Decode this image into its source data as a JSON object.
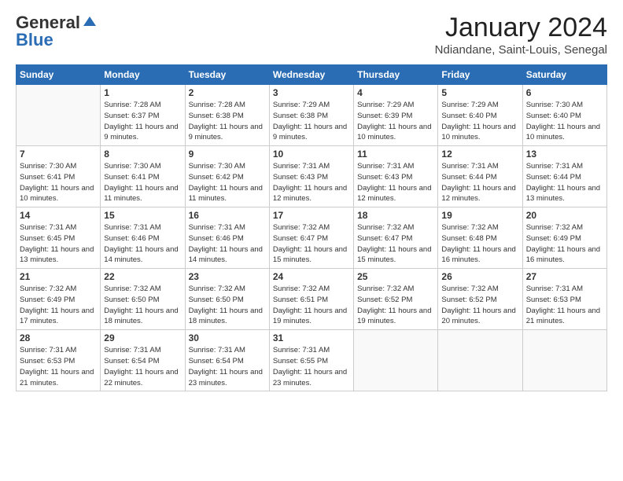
{
  "logo": {
    "general": "General",
    "blue": "Blue"
  },
  "header": {
    "month": "January 2024",
    "location": "Ndiandane, Saint-Louis, Senegal"
  },
  "weekdays": [
    "Sunday",
    "Monday",
    "Tuesday",
    "Wednesday",
    "Thursday",
    "Friday",
    "Saturday"
  ],
  "weeks": [
    [
      {
        "day": "",
        "sunrise": "",
        "sunset": "",
        "daylight": ""
      },
      {
        "day": "1",
        "sunrise": "Sunrise: 7:28 AM",
        "sunset": "Sunset: 6:37 PM",
        "daylight": "Daylight: 11 hours and 9 minutes."
      },
      {
        "day": "2",
        "sunrise": "Sunrise: 7:28 AM",
        "sunset": "Sunset: 6:38 PM",
        "daylight": "Daylight: 11 hours and 9 minutes."
      },
      {
        "day": "3",
        "sunrise": "Sunrise: 7:29 AM",
        "sunset": "Sunset: 6:38 PM",
        "daylight": "Daylight: 11 hours and 9 minutes."
      },
      {
        "day": "4",
        "sunrise": "Sunrise: 7:29 AM",
        "sunset": "Sunset: 6:39 PM",
        "daylight": "Daylight: 11 hours and 10 minutes."
      },
      {
        "day": "5",
        "sunrise": "Sunrise: 7:29 AM",
        "sunset": "Sunset: 6:40 PM",
        "daylight": "Daylight: 11 hours and 10 minutes."
      },
      {
        "day": "6",
        "sunrise": "Sunrise: 7:30 AM",
        "sunset": "Sunset: 6:40 PM",
        "daylight": "Daylight: 11 hours and 10 minutes."
      }
    ],
    [
      {
        "day": "7",
        "sunrise": "Sunrise: 7:30 AM",
        "sunset": "Sunset: 6:41 PM",
        "daylight": "Daylight: 11 hours and 10 minutes."
      },
      {
        "day": "8",
        "sunrise": "Sunrise: 7:30 AM",
        "sunset": "Sunset: 6:41 PM",
        "daylight": "Daylight: 11 hours and 11 minutes."
      },
      {
        "day": "9",
        "sunrise": "Sunrise: 7:30 AM",
        "sunset": "Sunset: 6:42 PM",
        "daylight": "Daylight: 11 hours and 11 minutes."
      },
      {
        "day": "10",
        "sunrise": "Sunrise: 7:31 AM",
        "sunset": "Sunset: 6:43 PM",
        "daylight": "Daylight: 11 hours and 12 minutes."
      },
      {
        "day": "11",
        "sunrise": "Sunrise: 7:31 AM",
        "sunset": "Sunset: 6:43 PM",
        "daylight": "Daylight: 11 hours and 12 minutes."
      },
      {
        "day": "12",
        "sunrise": "Sunrise: 7:31 AM",
        "sunset": "Sunset: 6:44 PM",
        "daylight": "Daylight: 11 hours and 12 minutes."
      },
      {
        "day": "13",
        "sunrise": "Sunrise: 7:31 AM",
        "sunset": "Sunset: 6:44 PM",
        "daylight": "Daylight: 11 hours and 13 minutes."
      }
    ],
    [
      {
        "day": "14",
        "sunrise": "Sunrise: 7:31 AM",
        "sunset": "Sunset: 6:45 PM",
        "daylight": "Daylight: 11 hours and 13 minutes."
      },
      {
        "day": "15",
        "sunrise": "Sunrise: 7:31 AM",
        "sunset": "Sunset: 6:46 PM",
        "daylight": "Daylight: 11 hours and 14 minutes."
      },
      {
        "day": "16",
        "sunrise": "Sunrise: 7:31 AM",
        "sunset": "Sunset: 6:46 PM",
        "daylight": "Daylight: 11 hours and 14 minutes."
      },
      {
        "day": "17",
        "sunrise": "Sunrise: 7:32 AM",
        "sunset": "Sunset: 6:47 PM",
        "daylight": "Daylight: 11 hours and 15 minutes."
      },
      {
        "day": "18",
        "sunrise": "Sunrise: 7:32 AM",
        "sunset": "Sunset: 6:47 PM",
        "daylight": "Daylight: 11 hours and 15 minutes."
      },
      {
        "day": "19",
        "sunrise": "Sunrise: 7:32 AM",
        "sunset": "Sunset: 6:48 PM",
        "daylight": "Daylight: 11 hours and 16 minutes."
      },
      {
        "day": "20",
        "sunrise": "Sunrise: 7:32 AM",
        "sunset": "Sunset: 6:49 PM",
        "daylight": "Daylight: 11 hours and 16 minutes."
      }
    ],
    [
      {
        "day": "21",
        "sunrise": "Sunrise: 7:32 AM",
        "sunset": "Sunset: 6:49 PM",
        "daylight": "Daylight: 11 hours and 17 minutes."
      },
      {
        "day": "22",
        "sunrise": "Sunrise: 7:32 AM",
        "sunset": "Sunset: 6:50 PM",
        "daylight": "Daylight: 11 hours and 18 minutes."
      },
      {
        "day": "23",
        "sunrise": "Sunrise: 7:32 AM",
        "sunset": "Sunset: 6:50 PM",
        "daylight": "Daylight: 11 hours and 18 minutes."
      },
      {
        "day": "24",
        "sunrise": "Sunrise: 7:32 AM",
        "sunset": "Sunset: 6:51 PM",
        "daylight": "Daylight: 11 hours and 19 minutes."
      },
      {
        "day": "25",
        "sunrise": "Sunrise: 7:32 AM",
        "sunset": "Sunset: 6:52 PM",
        "daylight": "Daylight: 11 hours and 19 minutes."
      },
      {
        "day": "26",
        "sunrise": "Sunrise: 7:32 AM",
        "sunset": "Sunset: 6:52 PM",
        "daylight": "Daylight: 11 hours and 20 minutes."
      },
      {
        "day": "27",
        "sunrise": "Sunrise: 7:31 AM",
        "sunset": "Sunset: 6:53 PM",
        "daylight": "Daylight: 11 hours and 21 minutes."
      }
    ],
    [
      {
        "day": "28",
        "sunrise": "Sunrise: 7:31 AM",
        "sunset": "Sunset: 6:53 PM",
        "daylight": "Daylight: 11 hours and 21 minutes."
      },
      {
        "day": "29",
        "sunrise": "Sunrise: 7:31 AM",
        "sunset": "Sunset: 6:54 PM",
        "daylight": "Daylight: 11 hours and 22 minutes."
      },
      {
        "day": "30",
        "sunrise": "Sunrise: 7:31 AM",
        "sunset": "Sunset: 6:54 PM",
        "daylight": "Daylight: 11 hours and 23 minutes."
      },
      {
        "day": "31",
        "sunrise": "Sunrise: 7:31 AM",
        "sunset": "Sunset: 6:55 PM",
        "daylight": "Daylight: 11 hours and 23 minutes."
      },
      {
        "day": "",
        "sunrise": "",
        "sunset": "",
        "daylight": ""
      },
      {
        "day": "",
        "sunrise": "",
        "sunset": "",
        "daylight": ""
      },
      {
        "day": "",
        "sunrise": "",
        "sunset": "",
        "daylight": ""
      }
    ]
  ]
}
